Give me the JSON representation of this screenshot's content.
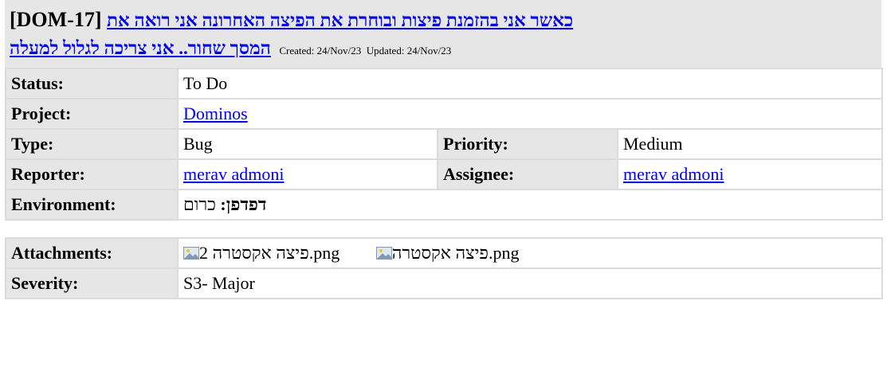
{
  "issue": {
    "key_bracket": "[DOM-17]",
    "title_line1": "כאשר אני בהזמנת פיצות ובוחרת את הפיצה האחרונה אני רואה את",
    "title_line2": "המסך שחור.. אני צריכה לגלול למעלה",
    "created_label": "Created:",
    "created": "24/Nov/23",
    "updated_label": "Updated:",
    "updated": "24/Nov/23"
  },
  "fields": {
    "status_label": "Status:",
    "status": "To Do",
    "project_label": "Project:",
    "project": "Dominos",
    "type_label": "Type:",
    "type": "Bug",
    "priority_label": "Priority:",
    "priority": "Medium",
    "reporter_label": "Reporter:",
    "reporter": "merav admoni",
    "assignee_label": "Assignee:",
    "assignee": "merav admoni",
    "environment_label": "Environment:",
    "environment_key": "דפדפן:",
    "environment_value": "כרום"
  },
  "extra": {
    "attachments_label": "Attachments:",
    "attachments": [
      "פיצה אקסטרה 2.png",
      "פיצה אקסטרה.png"
    ],
    "severity_label": "Severity:",
    "severity": "S3- Major"
  },
  "colors": {
    "label_bg": "#e6e6e6",
    "link": "#0000ee"
  }
}
